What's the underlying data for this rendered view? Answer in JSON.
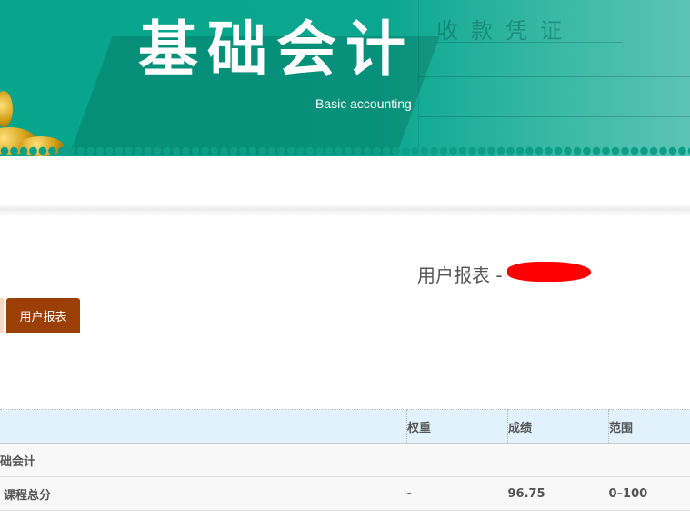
{
  "banner": {
    "title": "基础会计",
    "subtitle": "Basic accounting",
    "voucher_text": "收款凭证"
  },
  "report": {
    "title": "用户报表 -"
  },
  "tabs": [
    {
      "label": "用户报表",
      "active": true
    }
  ],
  "table": {
    "headers": [
      "",
      "权重",
      "成绩",
      "范围"
    ],
    "rows": [
      {
        "name": "础会计",
        "weight": "",
        "score": "",
        "range": ""
      },
      {
        "name": "课程总分",
        "weight": "-",
        "score": "96.75",
        "range": "0–100"
      }
    ]
  },
  "colors": {
    "banner": "#0aa68f",
    "tab_active": "#9b3f07",
    "table_header": "#e1f2fd"
  }
}
